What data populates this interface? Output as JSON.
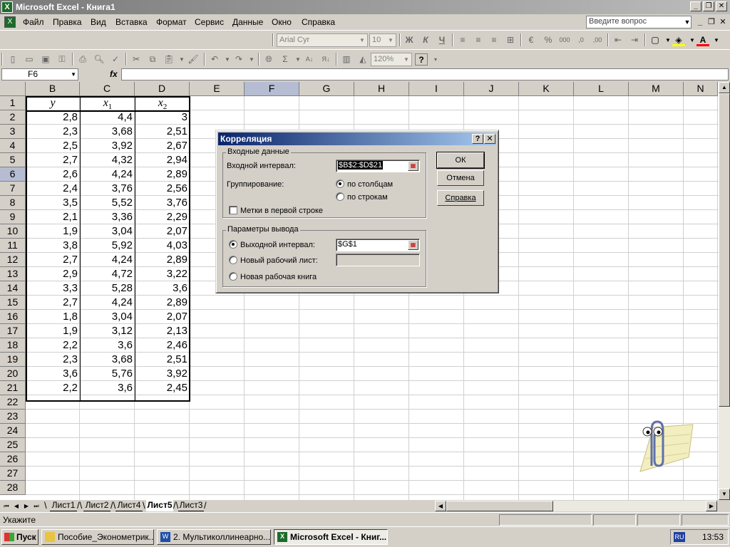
{
  "window": {
    "title": "Microsoft Excel - Книга1",
    "app_icon_label": "X",
    "doc_icon_label": "X"
  },
  "menu": {
    "items": [
      "Файл",
      "Правка",
      "Вид",
      "Вставка",
      "Формат",
      "Сервис",
      "Данные",
      "Окно",
      "Справка"
    ],
    "help_placeholder": "Введите вопрос"
  },
  "toolbar": {
    "font_name": "Arial Cyr",
    "font_size": "10",
    "zoom": "120%",
    "bold": "Ж",
    "italic": "К",
    "underline": "Ч"
  },
  "formula_bar": {
    "cell_ref": "F6",
    "fx": "fx"
  },
  "sheet": {
    "columns": [
      "B",
      "C",
      "D",
      "E",
      "F",
      "G",
      "H",
      "I",
      "J",
      "K",
      "L",
      "M",
      "N"
    ],
    "selected_column": "F",
    "rows": [
      "1",
      "2",
      "3",
      "4",
      "5",
      "6",
      "7",
      "8",
      "9",
      "10",
      "11",
      "12",
      "13",
      "14",
      "15",
      "16",
      "17",
      "18",
      "19",
      "20",
      "21",
      "22",
      "23",
      "24",
      "25",
      "26",
      "27",
      "28"
    ],
    "selected_row": "6",
    "headers": {
      "y": "y",
      "x1_base": "x",
      "x1_sub": "1",
      "x2_base": "x",
      "x2_sub": "2"
    },
    "data": [
      [
        "2,8",
        "4,4",
        "3"
      ],
      [
        "2,3",
        "3,68",
        "2,51"
      ],
      [
        "2,5",
        "3,92",
        "2,67"
      ],
      [
        "2,7",
        "4,32",
        "2,94"
      ],
      [
        "2,6",
        "4,24",
        "2,89"
      ],
      [
        "2,4",
        "3,76",
        "2,56"
      ],
      [
        "3,5",
        "5,52",
        "3,76"
      ],
      [
        "2,1",
        "3,36",
        "2,29"
      ],
      [
        "1,9",
        "3,04",
        "2,07"
      ],
      [
        "3,8",
        "5,92",
        "4,03"
      ],
      [
        "2,7",
        "4,24",
        "2,89"
      ],
      [
        "2,9",
        "4,72",
        "3,22"
      ],
      [
        "3,3",
        "5,28",
        "3,6"
      ],
      [
        "2,7",
        "4,24",
        "2,89"
      ],
      [
        "1,8",
        "3,04",
        "2,07"
      ],
      [
        "1,9",
        "3,12",
        "2,13"
      ],
      [
        "2,2",
        "3,6",
        "2,46"
      ],
      [
        "2,3",
        "3,68",
        "2,51"
      ],
      [
        "3,6",
        "5,76",
        "3,92"
      ],
      [
        "2,2",
        "3,6",
        "2,45"
      ]
    ]
  },
  "tabs": {
    "sheets": [
      "Лист1",
      "Лист2",
      "Лист4",
      "Лист5",
      "Лист3"
    ],
    "active": "Лист5"
  },
  "status": {
    "text": "Укажите"
  },
  "taskbar": {
    "start": "Пуск",
    "tasks": [
      "Пособие_Эконометрик...",
      "2. Мультиколлинеарно...",
      "Microsoft Excel - Книг..."
    ],
    "active_task": "Microsoft Excel - Книг...",
    "lang": "RU",
    "clock": "13:53"
  },
  "dialog": {
    "title": "Корреляция",
    "help_btn": "?",
    "close_btn": "✕",
    "input_group": "Входные данные",
    "input_range_label": "Входной интервал:",
    "input_range_value": "$B$2:$D$21",
    "grouping_label": "Группирование:",
    "by_columns": "по столбцам",
    "by_rows": "по строкам",
    "labels_first_row": "Метки в первой строке",
    "output_group": "Параметры вывода",
    "output_range_label": "Выходной интервал:",
    "output_range_value": "$G$1",
    "new_sheet_label": "Новый рабочий лист:",
    "new_book_label": "Новая рабочая книга",
    "ok": "ОК",
    "cancel": "Отмена",
    "help": "Справка"
  }
}
